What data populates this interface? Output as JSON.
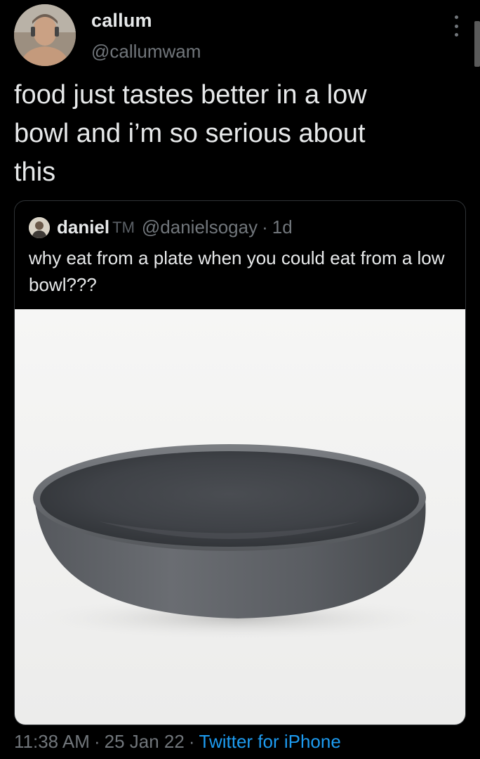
{
  "tweet": {
    "display_name": "callum",
    "handle": "@callumwam",
    "text": "food just tastes better in a low\nbowl and i’m so serious about\nthis",
    "avatar_icon": "user-avatar-photo",
    "more_icon": "more-vertical-icon"
  },
  "quoted_tweet": {
    "display_name": "daniel",
    "name_suffix": "TM",
    "handle": "@danielsogay",
    "separator": "·",
    "time": "1d",
    "text": "why eat from a plate when you could eat from a low bowl???",
    "image_subject": "grey-low-bowl-photo"
  },
  "footer": {
    "time": "11:38 AM",
    "date": "25 Jan 22",
    "separator": "·",
    "source": "Twitter for iPhone"
  },
  "colors": {
    "background": "#000000",
    "primary_text": "#e7e9ea",
    "secondary_text": "#71767b",
    "link": "#1d9bf0",
    "border": "#2f3336"
  }
}
